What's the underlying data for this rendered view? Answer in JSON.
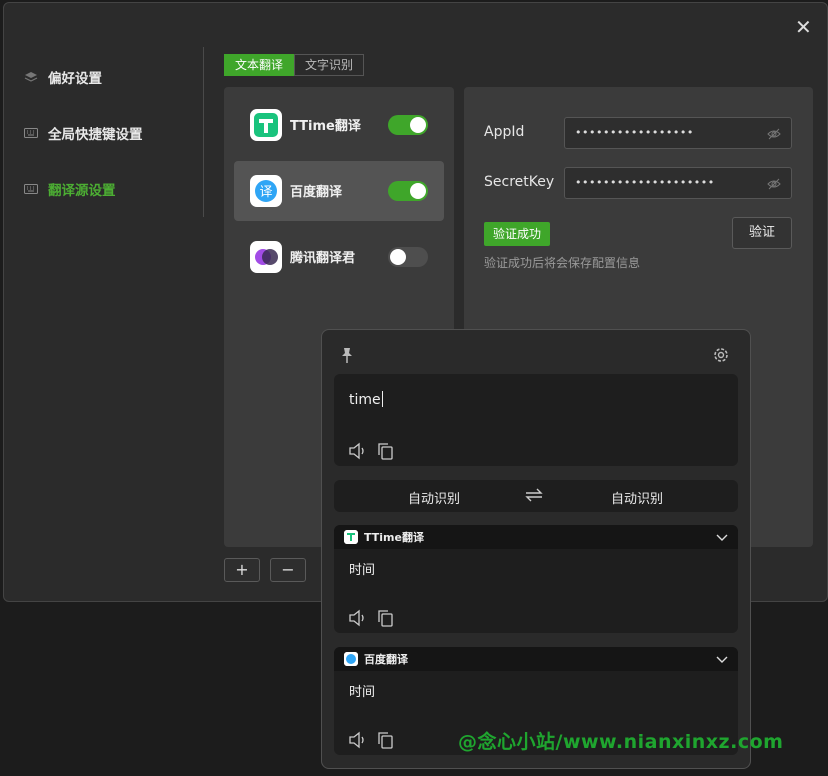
{
  "sidebar": {
    "items": [
      {
        "label": "偏好设置",
        "icon": "layers-icon"
      },
      {
        "label": "全局快捷键设置",
        "icon": "keyboard-icon"
      },
      {
        "label": "翻译源设置",
        "icon": "keyboard-icon",
        "active": true
      }
    ]
  },
  "tabs": [
    {
      "label": "文本翻译",
      "active": true
    },
    {
      "label": "文字识别",
      "active": false
    }
  ],
  "sources": [
    {
      "name": "TTime翻译",
      "enabled": true
    },
    {
      "name": "百度翻译",
      "enabled": true,
      "selected": true
    },
    {
      "name": "腾讯翻译君",
      "enabled": false
    }
  ],
  "config": {
    "appid_label": "AppId",
    "appid_value": "•••••••••••••••••",
    "secret_label": "SecretKey",
    "secret_value": "••••••••••••••••••••",
    "verify_status": "验证成功",
    "verify_button": "验证",
    "hint": "验证成功后将会保存配置信息"
  },
  "list_buttons": {
    "add": "+",
    "remove": "−"
  },
  "popup": {
    "input_text": "time",
    "source_lang": "自动识别",
    "target_lang": "自动识别",
    "results": [
      {
        "provider": "TTime翻译",
        "text": "时间"
      },
      {
        "provider": "百度翻译",
        "text": "时间"
      }
    ]
  },
  "watermark": "@念心小站/www.nianxinxz.com",
  "colors": {
    "accent": "#3fa62a",
    "active_text": "#4cae33"
  }
}
